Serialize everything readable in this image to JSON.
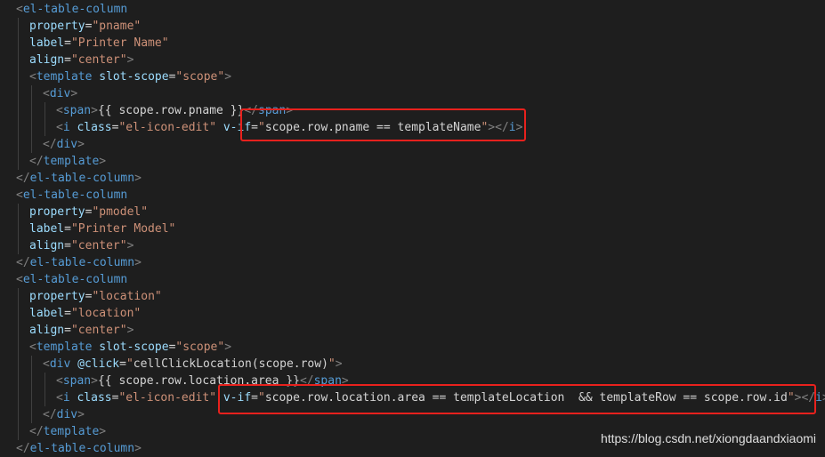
{
  "editor": {
    "theme_colors": {
      "background": "#1e1e1e",
      "punctuation": "#808080",
      "tag": "#569cd6",
      "attribute": "#9cdcfe",
      "string": "#ce9178",
      "text": "#d4d4d4",
      "annotation_box": "#e8211d"
    },
    "lines": [
      {
        "indent": 0,
        "tokens": [
          [
            "p",
            "<"
          ],
          [
            "t",
            "el-table-column"
          ]
        ]
      },
      {
        "indent": 1,
        "tokens": [
          [
            "a",
            "property"
          ],
          [
            "x",
            "="
          ],
          [
            "s",
            "\"pname\""
          ]
        ]
      },
      {
        "indent": 1,
        "tokens": [
          [
            "a",
            "label"
          ],
          [
            "x",
            "="
          ],
          [
            "s",
            "\"Printer Name\""
          ]
        ]
      },
      {
        "indent": 1,
        "tokens": [
          [
            "a",
            "align"
          ],
          [
            "x",
            "="
          ],
          [
            "s",
            "\"center\""
          ],
          [
            "p",
            ">"
          ]
        ]
      },
      {
        "indent": 1,
        "tokens": [
          [
            "p",
            "<"
          ],
          [
            "t",
            "template"
          ],
          [
            "x",
            " "
          ],
          [
            "a",
            "slot-scope"
          ],
          [
            "x",
            "="
          ],
          [
            "s",
            "\"scope\""
          ],
          [
            "p",
            ">"
          ]
        ]
      },
      {
        "indent": 2,
        "tokens": [
          [
            "p",
            "<"
          ],
          [
            "t",
            "div"
          ],
          [
            "p",
            ">"
          ]
        ]
      },
      {
        "indent": 3,
        "tokens": [
          [
            "p",
            "<"
          ],
          [
            "t",
            "span"
          ],
          [
            "p",
            ">"
          ],
          [
            "x",
            "{{ scope.row.pname }}"
          ],
          [
            "p",
            "</"
          ],
          [
            "t",
            "span"
          ],
          [
            "p",
            ">"
          ]
        ]
      },
      {
        "indent": 3,
        "tokens": [
          [
            "p",
            "<"
          ],
          [
            "t",
            "i"
          ],
          [
            "x",
            " "
          ],
          [
            "a",
            "class"
          ],
          [
            "x",
            "="
          ],
          [
            "s",
            "\"el-icon-edit\""
          ],
          [
            "x",
            " "
          ],
          [
            "a",
            "v-if"
          ],
          [
            "x",
            "="
          ],
          [
            "s",
            "\""
          ],
          [
            "x",
            "scope.row.pname == templateName"
          ],
          [
            "s",
            "\""
          ],
          [
            "p",
            "></"
          ],
          [
            "t",
            "i"
          ],
          [
            "p",
            ">"
          ]
        ]
      },
      {
        "indent": 2,
        "tokens": [
          [
            "p",
            "</"
          ],
          [
            "t",
            "div"
          ],
          [
            "p",
            ">"
          ]
        ]
      },
      {
        "indent": 1,
        "tokens": [
          [
            "p",
            "</"
          ],
          [
            "t",
            "template"
          ],
          [
            "p",
            ">"
          ]
        ]
      },
      {
        "indent": 0,
        "tokens": [
          [
            "p",
            "</"
          ],
          [
            "t",
            "el-table-column"
          ],
          [
            "p",
            ">"
          ]
        ]
      },
      {
        "indent": 0,
        "tokens": [
          [
            "p",
            "<"
          ],
          [
            "t",
            "el-table-column"
          ]
        ]
      },
      {
        "indent": 1,
        "tokens": [
          [
            "a",
            "property"
          ],
          [
            "x",
            "="
          ],
          [
            "s",
            "\"pmodel\""
          ]
        ]
      },
      {
        "indent": 1,
        "tokens": [
          [
            "a",
            "label"
          ],
          [
            "x",
            "="
          ],
          [
            "s",
            "\"Printer Model\""
          ]
        ]
      },
      {
        "indent": 1,
        "tokens": [
          [
            "a",
            "align"
          ],
          [
            "x",
            "="
          ],
          [
            "s",
            "\"center\""
          ],
          [
            "p",
            ">"
          ]
        ]
      },
      {
        "indent": 0,
        "tokens": [
          [
            "p",
            "</"
          ],
          [
            "t",
            "el-table-column"
          ],
          [
            "p",
            ">"
          ]
        ]
      },
      {
        "indent": 0,
        "tokens": [
          [
            "p",
            "<"
          ],
          [
            "t",
            "el-table-column"
          ]
        ]
      },
      {
        "indent": 1,
        "tokens": [
          [
            "a",
            "property"
          ],
          [
            "x",
            "="
          ],
          [
            "s",
            "\"location\""
          ]
        ]
      },
      {
        "indent": 1,
        "tokens": [
          [
            "a",
            "label"
          ],
          [
            "x",
            "="
          ],
          [
            "s",
            "\"location\""
          ]
        ]
      },
      {
        "indent": 1,
        "tokens": [
          [
            "a",
            "align"
          ],
          [
            "x",
            "="
          ],
          [
            "s",
            "\"center\""
          ],
          [
            "p",
            ">"
          ]
        ]
      },
      {
        "indent": 1,
        "tokens": [
          [
            "p",
            "<"
          ],
          [
            "t",
            "template"
          ],
          [
            "x",
            " "
          ],
          [
            "a",
            "slot-scope"
          ],
          [
            "x",
            "="
          ],
          [
            "s",
            "\"scope\""
          ],
          [
            "p",
            ">"
          ]
        ]
      },
      {
        "indent": 2,
        "tokens": [
          [
            "p",
            "<"
          ],
          [
            "t",
            "div"
          ],
          [
            "x",
            " "
          ],
          [
            "a",
            "@click"
          ],
          [
            "x",
            "="
          ],
          [
            "s",
            "\""
          ],
          [
            "x",
            "cellClickLocation(scope.row)"
          ],
          [
            "s",
            "\""
          ],
          [
            "p",
            ">"
          ]
        ]
      },
      {
        "indent": 3,
        "tokens": [
          [
            "p",
            "<"
          ],
          [
            "t",
            "span"
          ],
          [
            "p",
            ">"
          ],
          [
            "x",
            "{{ scope.row.location.area }}"
          ],
          [
            "p",
            "</"
          ],
          [
            "t",
            "span"
          ],
          [
            "p",
            ">"
          ]
        ]
      },
      {
        "indent": 3,
        "tokens": [
          [
            "p",
            "<"
          ],
          [
            "t",
            "i"
          ],
          [
            "x",
            " "
          ],
          [
            "a",
            "class"
          ],
          [
            "x",
            "="
          ],
          [
            "s",
            "\"el-icon-edit\""
          ],
          [
            "x",
            " "
          ],
          [
            "a",
            "v-if"
          ],
          [
            "x",
            "="
          ],
          [
            "s",
            "\""
          ],
          [
            "x",
            "scope.row.location.area == templateLocation  && templateRow == scope.row.id"
          ],
          [
            "s",
            "\""
          ],
          [
            "p",
            "></"
          ],
          [
            "t",
            "i"
          ],
          [
            "p",
            ">"
          ]
        ]
      },
      {
        "indent": 2,
        "tokens": [
          [
            "p",
            "</"
          ],
          [
            "t",
            "div"
          ],
          [
            "p",
            ">"
          ]
        ]
      },
      {
        "indent": 1,
        "tokens": [
          [
            "p",
            "</"
          ],
          [
            "t",
            "template"
          ],
          [
            "p",
            ">"
          ]
        ]
      },
      {
        "indent": 0,
        "tokens": [
          [
            "p",
            "</"
          ],
          [
            "t",
            "el-table-column"
          ],
          [
            "p",
            ">"
          ]
        ]
      }
    ]
  },
  "watermark": {
    "text": "https://blog.csdn.net/xiongdaandxiaomi"
  }
}
